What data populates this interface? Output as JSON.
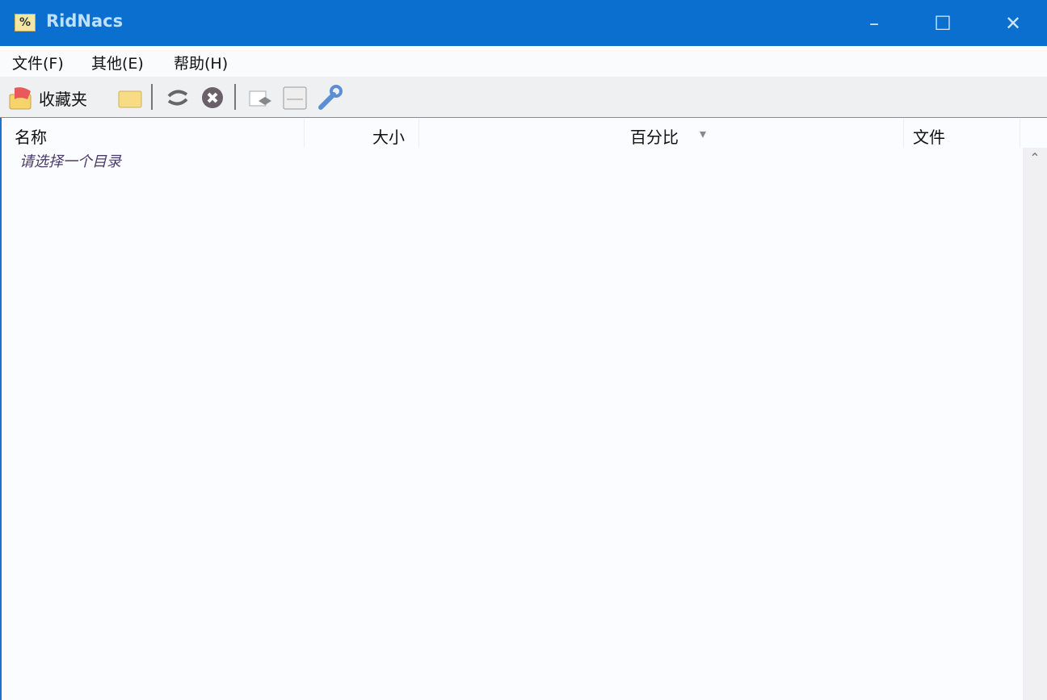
{
  "window": {
    "title": "RidNacs",
    "minimize": "–",
    "maximize": "☐",
    "close": "✕"
  },
  "menu": [
    "文件(F)",
    "其他(E)",
    "帮助(H)"
  ],
  "toolbar": {
    "favorites_label": "收藏夹"
  },
  "columns": [
    "名称",
    "大小",
    "百分比",
    "文件"
  ],
  "sort_indicator": "▾",
  "list": {
    "placeholder": "请选择一个目录"
  },
  "scrollbar": {
    "up": "⌃"
  }
}
